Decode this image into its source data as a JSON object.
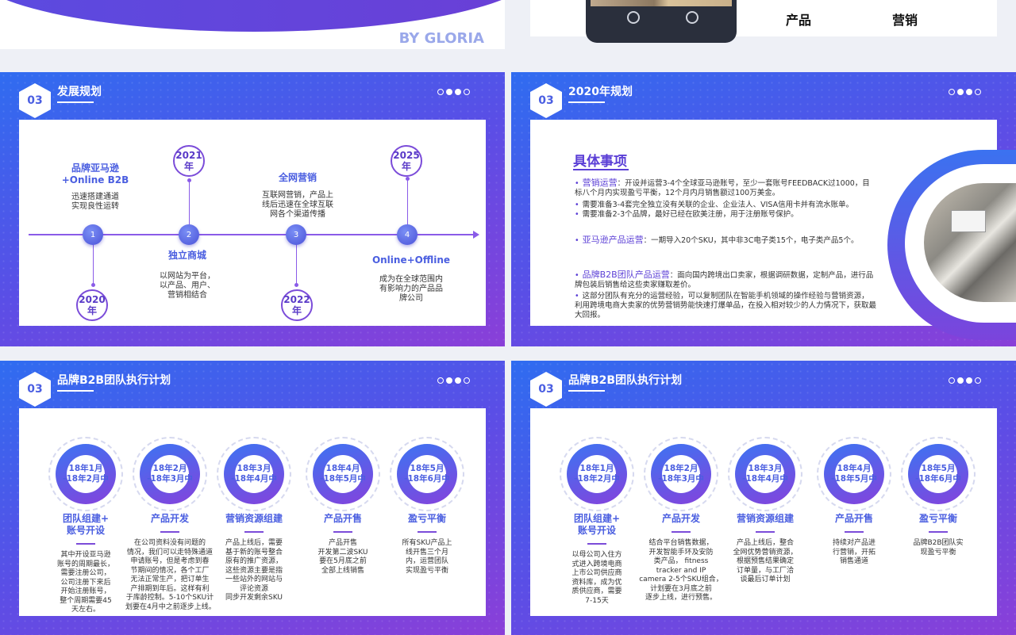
{
  "top": {
    "byline": "BY GLORIA",
    "labels": [
      "产品",
      "营销"
    ]
  },
  "slides": {
    "dev": {
      "num": "03",
      "title": "发展规划",
      "years": [
        "2020\n年",
        "2021\n年",
        "2022\n年",
        "2025\n年"
      ],
      "nodes": [
        "1",
        "2",
        "3",
        "4"
      ],
      "milestones": [
        {
          "title": "品牌亚马逊\n+Online B2B",
          "text": "迅速搭建通道\n实现良性运转"
        },
        {
          "title": "独立商城",
          "text": "以网站为平台，\n以产品、用户、\n营销相结合"
        },
        {
          "title": "全网营销",
          "text": "互联网营销，产品上\n线后迅速在全球互联\n网各个渠道传播"
        },
        {
          "title": "Online+Offline",
          "text": "成为在全球范围内\n有影响力的产品品\n牌公司"
        }
      ]
    },
    "plan2020": {
      "num": "03",
      "title": "2020年规划",
      "heading": "具体事项",
      "items": [
        {
          "head": "营销运营",
          "text": "：开设并运营3-4个全球亚马逊账号，至少一套账号FEEDBACK过1000，目标八个月内实现盈亏平衡，12个月内月销售额过100万美金。"
        },
        {
          "head": "",
          "text": "需要准备3-4套完全独立没有关联的企业、企业法人、VISA信用卡并有流水账单。"
        },
        {
          "head": "",
          "text": "需要准备2-3个品牌，最好已经在欧美注册，用于注册账号保护。"
        },
        {
          "head": "亚马逊产品运营",
          "text": "：一期导入20个SKU，其中非3C电子类15个，电子类产品5个。"
        },
        {
          "head": "品牌B2B团队产品运营",
          "text": "：面向国内跨境出口卖家，根据调研数据，定制产品，进行品牌包装后销售给这些卖家赚取差价。"
        },
        {
          "head": "",
          "text": "这部分团队有充分的运营经验，可以复制团队在智能手机领域的操作经验与营销资源，利用跨境电商大卖家的优势营销势能快速打爆单品，在投入相对较少的人力情况下，获取最大回报。"
        }
      ]
    },
    "b2bA": {
      "num": "03",
      "title": "品牌B2B团队执行计划",
      "steps": [
        {
          "date": "18年1月\n-18年2月中",
          "title": "团队组建+\n账号开设",
          "text": "其中开设亚马逊\n账号的周期最长，\n需要注册公司，\n公司注册下来后\n开始注册账号，\n整个周期需要45\n天左右。"
        },
        {
          "date": "18年2月\n-18年3月中",
          "title": "产品开发",
          "text": "在公司资料没有问题的\n情况，我们可以走特殊通道\n申请账号，但是考虑到春\n节期间的情况，各个工厂\n无法正常生产，把订单生\n产排期到年后。这样有利\n于库龄控制。5-10个SKU计\n划要在4月中之前逐步上线。"
        },
        {
          "date": "18年3月\n-18年4月中",
          "title": "营销资源组建",
          "text": "产品上线后，需要\n基于新的账号整合\n原有的推广资源，\n这些资源主要是指\n一些站外的网站与\n评论资源\n同步开发剩余SKU"
        },
        {
          "date": "18年4月\n-18年5月中",
          "title": "产品开售",
          "text": "产品开售\n开发第二波SKU\n要在5月底之前\n全部上线销售"
        },
        {
          "date": "18年5月\n-18年6月中",
          "title": "盈亏平衡",
          "text": "所有SKU产品上\n线开售三个月\n内，运营团队\n实现盈亏平衡"
        }
      ]
    },
    "b2bB": {
      "num": "03",
      "title": "品牌B2B团队执行计划",
      "steps": [
        {
          "date": "18年1月\n-18年2月中",
          "title": "团队组建+\n账号开设",
          "text": "以母公司入住方\n式进入跨境电商\n上市公司供应商\n资料库，成为优\n质供应商，需要\n7-15天"
        },
        {
          "date": "18年2月\n-18年3月中",
          "title": "产品开发",
          "text": "结合平台销售数据，\n开发智能手环及安防\n类产品， fitness\ntracker and IP\ncamera 2-5个SKU组合，\n计划要在3月底之前\n逐步上线，进行预售。"
        },
        {
          "date": "18年3月\n-18年4月中",
          "title": "营销资源组建",
          "text": "产品上线后，整合\n全网优势营销资源，\n根据预售结果确定\n订单量，与工厂洽\n谈最后订单计划"
        },
        {
          "date": "18年4月\n-18年5月中",
          "title": "产品开售",
          "text": "持续对产品进\n行营销，开拓\n销售通道"
        },
        {
          "date": "18年5月\n-18年6月中",
          "title": "盈亏平衡",
          "text": "品牌B2B团队实\n现盈亏平衡"
        }
      ]
    }
  }
}
